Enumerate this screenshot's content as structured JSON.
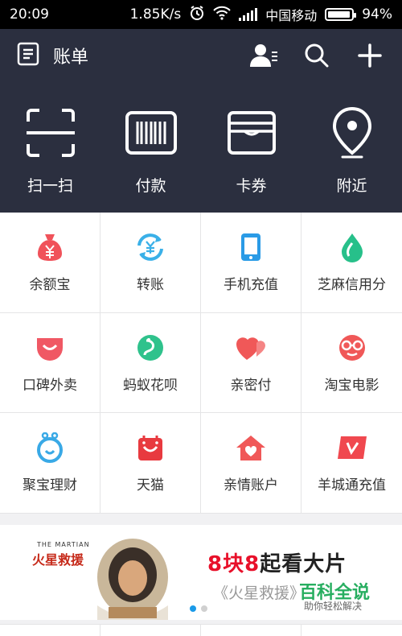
{
  "status": {
    "time": "20:09",
    "speed": "1.85K/s",
    "operator": "中国移动",
    "battery": "94%",
    "battery_level": 0.94
  },
  "header": {
    "title": "账单",
    "quick": [
      {
        "label": "扫一扫",
        "icon": "scan-icon"
      },
      {
        "label": "付款",
        "icon": "barcode-icon"
      },
      {
        "label": "卡券",
        "icon": "wallet-icon"
      },
      {
        "label": "附近",
        "icon": "location-pin-icon"
      }
    ]
  },
  "grid": [
    {
      "label": "余额宝",
      "icon": "money-bag-icon",
      "color": "#f0525a"
    },
    {
      "label": "转账",
      "icon": "transfer-icon",
      "color": "#3ab0e8"
    },
    {
      "label": "手机充值",
      "icon": "phone-icon",
      "color": "#2a9be6"
    },
    {
      "label": "芝麻信用分",
      "icon": "sesame-drop-icon",
      "color": "#27c08a"
    },
    {
      "label": "口碑外卖",
      "icon": "smile-icon",
      "color": "#f05864"
    },
    {
      "label": "蚂蚁花呗",
      "icon": "huabei-icon",
      "color": "#2fc28c"
    },
    {
      "label": "亲密付",
      "icon": "hearts-icon",
      "color": "#f05858"
    },
    {
      "label": "淘宝电影",
      "icon": "glasses-face-icon",
      "color": "#f05858"
    },
    {
      "label": "聚宝理财",
      "icon": "jubao-icon",
      "color": "#39a9e6"
    },
    {
      "label": "天猫",
      "icon": "tmall-bag-icon",
      "color": "#e83a3f"
    },
    {
      "label": "亲情账户",
      "icon": "home-heart-icon",
      "color": "#f05858"
    },
    {
      "label": "羊城通充值",
      "icon": "v-card-icon",
      "color": "#f0484f"
    }
  ],
  "banner": {
    "logo_small": "THE MARTIAN",
    "logo": "火星救援",
    "headline_red": "8块8",
    "headline_dark": "起看大片",
    "sub": "《火星救援》",
    "watermark": "百科全说",
    "watermark_sub": "助你轻松解决"
  },
  "colors": {
    "header_bg": "#2b2f3f",
    "accent": "#1a9ae8"
  }
}
